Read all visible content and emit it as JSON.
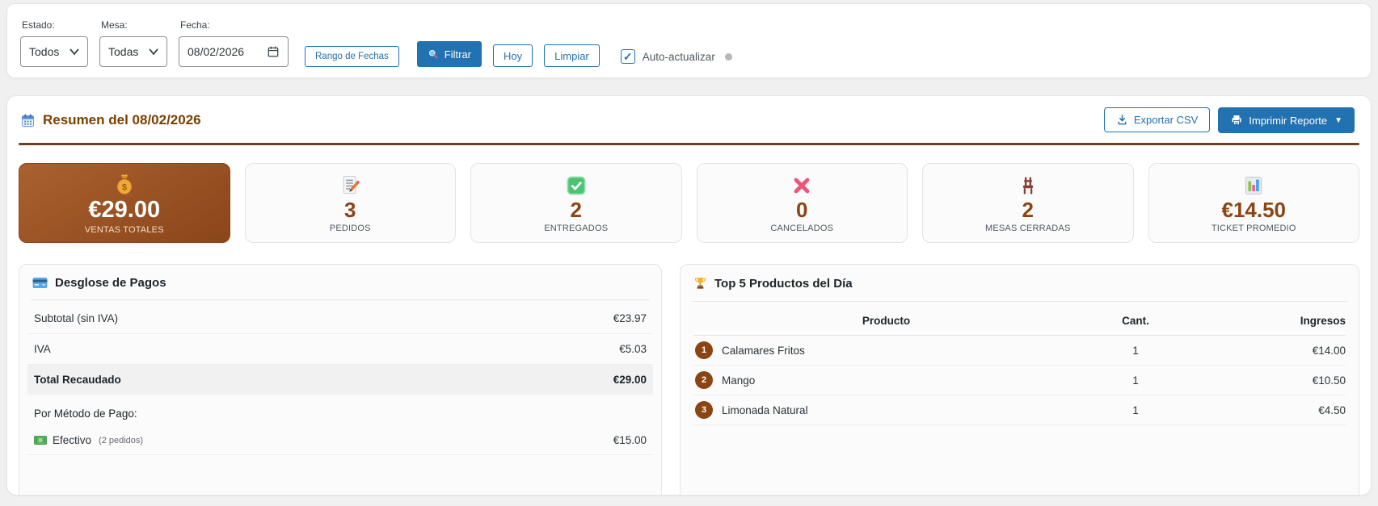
{
  "filters": {
    "estado_label": "Estado:",
    "estado_value": "Todos",
    "mesa_label": "Mesa:",
    "mesa_value": "Todas",
    "fecha_label": "Fecha:",
    "fecha_value": "08/02/2026",
    "range_button": "Rango de Fechas",
    "filter_button": "Filtrar",
    "today_button": "Hoy",
    "clear_button": "Limpiar",
    "auto_refresh_label": "Auto-actualizar"
  },
  "icons": {
    "checkbox_check": "✓",
    "print_caret": "▼"
  },
  "header": {
    "title": "Resumen del 08/02/2026",
    "export_csv": "Exportar CSV",
    "print_report": "Imprimir Reporte"
  },
  "stats": [
    {
      "icon": "money-bag-icon",
      "value": "€29.00",
      "label": "VENTAS TOTALES"
    },
    {
      "icon": "memo-icon",
      "value": "3",
      "label": "PEDIDOS"
    },
    {
      "icon": "check-icon",
      "value": "2",
      "label": "ENTREGADOS"
    },
    {
      "icon": "cross-icon",
      "value": "0",
      "label": "CANCELADOS"
    },
    {
      "icon": "chair-icon",
      "value": "2",
      "label": "MESAS CERRADAS"
    },
    {
      "icon": "bar-chart-icon",
      "value": "€14.50",
      "label": "TICKET PROMEDIO"
    }
  ],
  "payments": {
    "title": "Desglose de Pagos",
    "rows": [
      {
        "label": "Subtotal (sin IVA)",
        "value": "€23.97"
      },
      {
        "label": "IVA",
        "value": "€5.03"
      },
      {
        "label": "Total Recaudado",
        "value": "€29.00"
      }
    ],
    "method_header": "Por Método de Pago:",
    "methods": [
      {
        "name": "Efectivo",
        "detail": "(2 pedidos)",
        "value": "€15.00"
      }
    ]
  },
  "top_products": {
    "title": "Top 5 Productos del Día",
    "columns": [
      "Producto",
      "Cant.",
      "Ingresos"
    ],
    "rows": [
      {
        "rank": "1",
        "name": "Calamares Fritos",
        "qty": "1",
        "revenue": "€14.00"
      },
      {
        "rank": "2",
        "name": "Mango",
        "qty": "1",
        "revenue": "€10.50"
      },
      {
        "rank": "3",
        "name": "Limonada Natural",
        "qty": "1",
        "revenue": "€4.50"
      }
    ]
  },
  "colors": {
    "accent_blue": "#2271b1",
    "title_brown": "#7b3f00",
    "stat_brown": "#8b4513",
    "divider_brown": "#6b4226",
    "highlight_row": "#f1f1f1"
  }
}
